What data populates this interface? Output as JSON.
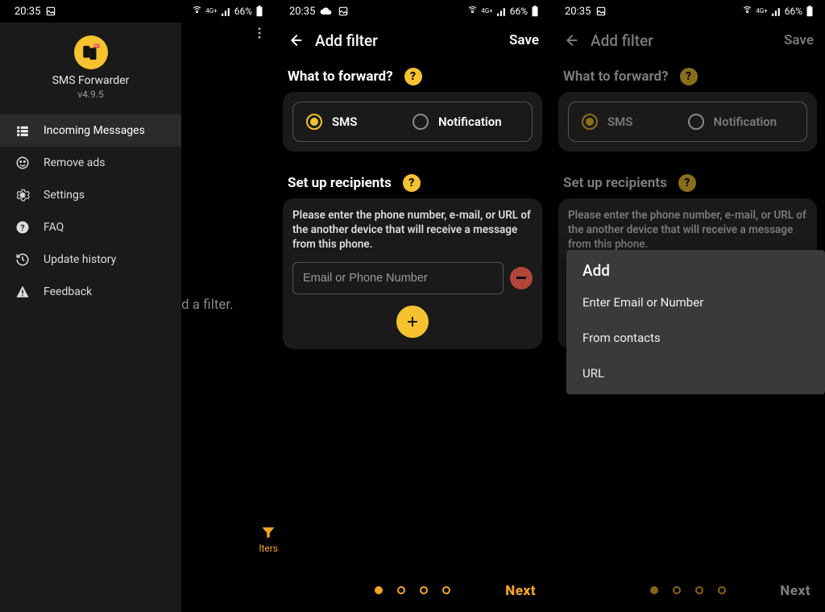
{
  "status": {
    "time": "20:35",
    "battery": "66%"
  },
  "phone1": {
    "app_name": "SMS Forwarder",
    "version": "v4.9.5",
    "menu": [
      {
        "label": "Incoming Messages"
      },
      {
        "label": "Remove ads"
      },
      {
        "label": "Settings"
      },
      {
        "label": "FAQ"
      },
      {
        "label": "Update history"
      },
      {
        "label": "Feedback"
      }
    ],
    "hint_text": "d a filter.",
    "fab_label": "lters"
  },
  "appbar": {
    "title": "Add filter",
    "save": "Save"
  },
  "section_forward": {
    "title": "What to forward?",
    "opt_sms": "SMS",
    "opt_notification": "Notification"
  },
  "section_recipients": {
    "title": "Set up recipients",
    "helper": "Please enter the phone number, e-mail, or URL of the another device that will receive a message from this phone.",
    "placeholder": "Email or Phone Number"
  },
  "next": "Next",
  "dialog": {
    "title": "Add",
    "items": [
      "Enter Email or Number",
      "From contacts",
      "URL"
    ]
  }
}
